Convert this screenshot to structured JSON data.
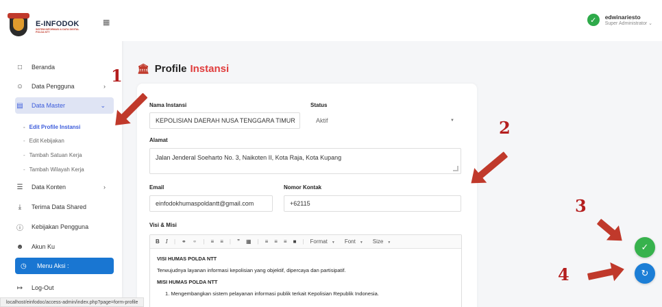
{
  "brand": {
    "title": "E-INFODOK",
    "subtitle": "SISTEM INFORMASI & DATA DIGITAL POLDA NTT"
  },
  "header": {
    "user_name": "edwinariesto",
    "user_role": "Super Administrator"
  },
  "sidebar": {
    "items": [
      {
        "label": "Beranda",
        "icon": "home-icon"
      },
      {
        "label": "Data Pengguna",
        "icon": "users-icon"
      },
      {
        "label": "Data Master",
        "icon": "database-icon"
      },
      {
        "label": "Data Konten",
        "icon": "layers-icon"
      },
      {
        "label": "Terima Data Shared",
        "icon": "download-icon"
      },
      {
        "label": "Kebijakan Pengguna",
        "icon": "help-icon"
      },
      {
        "label": "Akun Ku",
        "icon": "user-icon"
      },
      {
        "label": "Log-Out",
        "icon": "logout-icon"
      }
    ],
    "sub_items": [
      {
        "label": "Edit Profile Instansi"
      },
      {
        "label": "Edit Kebijakan"
      },
      {
        "label": "Tambah Satuan Kerja"
      },
      {
        "label": "Tambah Wilayah Kerja"
      }
    ],
    "menu_aksi": "Menu Aksi :"
  },
  "page": {
    "title": "Profile",
    "title_accent": "Instansi"
  },
  "form": {
    "nama_label": "Nama Instansi",
    "nama_value": "KEPOLISIAN DAERAH NUSA TENGGARA TIMUR",
    "status_label": "Status",
    "status_value": "Aktif",
    "alamat_label": "Alamat",
    "alamat_value": "Jalan Jenderal Soeharto No. 3, Naikoten II, Kota Raja, Kota Kupang",
    "email_label": "Email",
    "email_value": "einfodokhumaspoldantt@gmail.com",
    "kontak_label": "Nomor Kontak",
    "kontak_value": "+62115",
    "visi_label": "Visi & Misi"
  },
  "editor": {
    "format": "Format",
    "font": "Font",
    "size": "Size",
    "visi_heading": "VISI HUMAS POLDA NTT",
    "visi_text": "Terwujudnya layanan informasi kepolisian yang objektif, dipercaya dan partisipatif.",
    "misi_heading": "MISI HUMAS POLDA NTT",
    "misi_1": "1. Mengembangkan sistem pelayanan informasi publik terkait Kepolisian Republik Indonesia."
  },
  "status_bar": {
    "url": "localhost/einfodoc/access-admin/index.php?page=form-profile"
  },
  "annotations": [
    "1",
    "2",
    "3",
    "4"
  ],
  "colors": {
    "accent_blue": "#3b5bdb",
    "annotation_red": "#b41e1e",
    "save_green": "#37b24d",
    "reset_blue": "#1c7ed6"
  }
}
